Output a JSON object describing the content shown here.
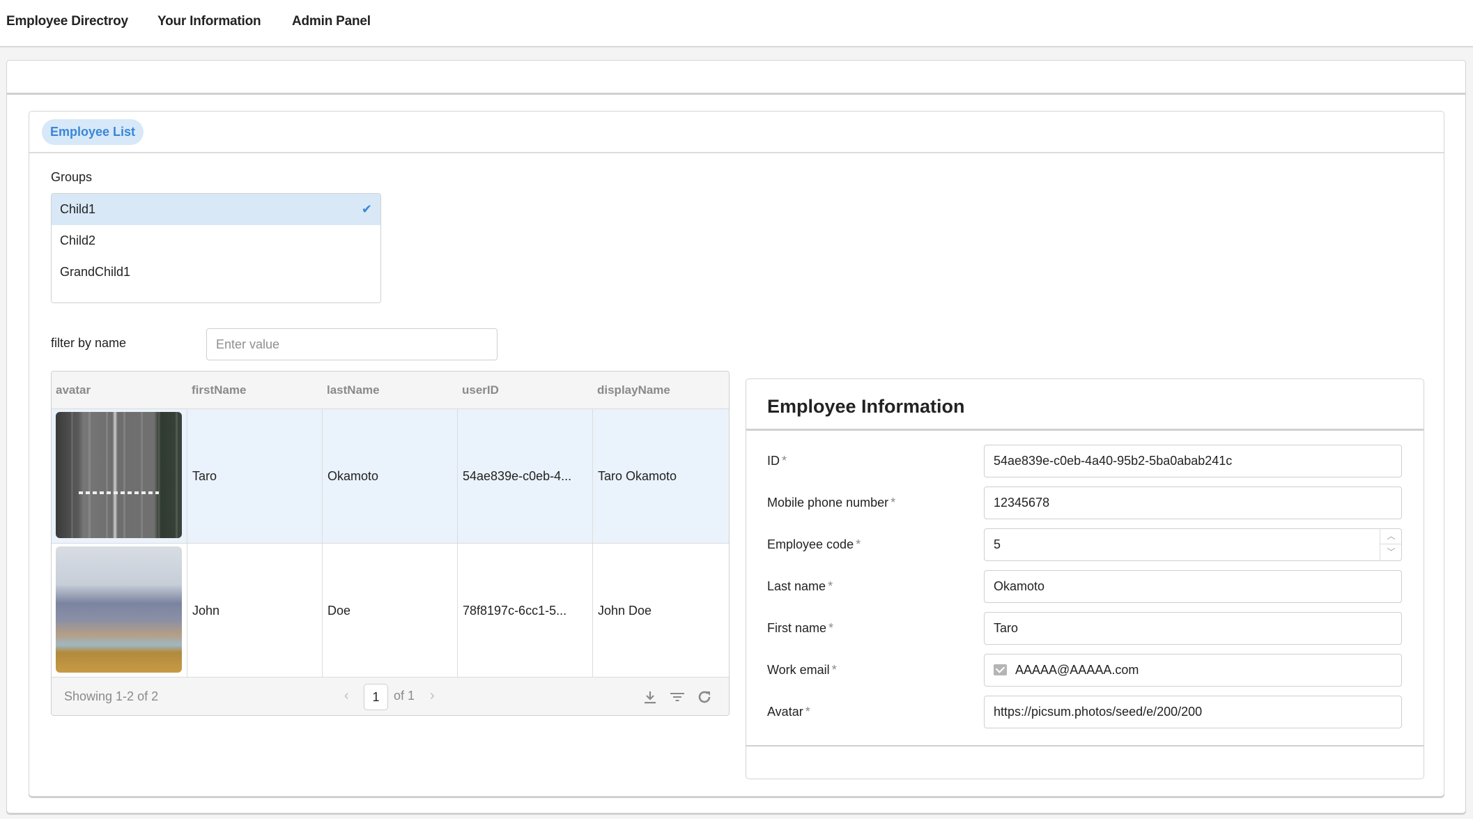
{
  "nav": {
    "items": [
      {
        "label": "Employee Directroy"
      },
      {
        "label": "Your Information"
      },
      {
        "label": "Admin Panel"
      }
    ]
  },
  "tabs": [
    {
      "label": "Employee List",
      "active": true
    }
  ],
  "groups": {
    "label": "Groups",
    "options": [
      {
        "label": "Child1",
        "selected": true
      },
      {
        "label": "Child2",
        "selected": false
      },
      {
        "label": "GrandChild1",
        "selected": false
      }
    ]
  },
  "filter": {
    "label": "filter by name",
    "value": "",
    "placeholder": "Enter value"
  },
  "table": {
    "columns": [
      "avatar",
      "firstName",
      "lastName",
      "userID",
      "displayName"
    ],
    "rows": [
      {
        "avatar": "aerial city road photo (grayscale)",
        "firstName": "Taro",
        "lastName": "Okamoto",
        "userID": "54ae839e-c0eb-4...",
        "displayName": "Taro Okamoto",
        "selected": true
      },
      {
        "avatar": "mountain lake landscape photo",
        "firstName": "John",
        "lastName": "Doe",
        "userID": "78f8197c-6cc1-5...",
        "displayName": "John Doe",
        "selected": false
      }
    ],
    "footer": {
      "showing": "Showing 1-2 of 2",
      "page": "1",
      "of_pages": "of 1",
      "prev_icon": "chevron-left-icon",
      "next_icon": "chevron-right-icon",
      "tools": [
        "download-icon",
        "filter-icon",
        "refresh-icon"
      ]
    }
  },
  "employee_info": {
    "title": "Employee Information",
    "required_mark": "*",
    "fields": [
      {
        "label": "ID",
        "value": "54ae839e-c0eb-4a40-95b2-5ba0abab241c"
      },
      {
        "label": "Mobile phone number",
        "value": "12345678"
      },
      {
        "label": "Employee code",
        "value": "5"
      },
      {
        "label": "Last name",
        "value": "Okamoto"
      },
      {
        "label": "First name",
        "value": "Taro"
      },
      {
        "label": "Work email",
        "value": "AAAAA@AAAAA.com"
      },
      {
        "label": "Avatar",
        "value": "https://picsum.photos/seed/e/200/200"
      }
    ]
  },
  "colors": {
    "accent": "#3a87d6",
    "tab_bg": "#d7e8f8",
    "selected_row": "#eaf2fb",
    "selected_option": "#d9e8f7"
  }
}
